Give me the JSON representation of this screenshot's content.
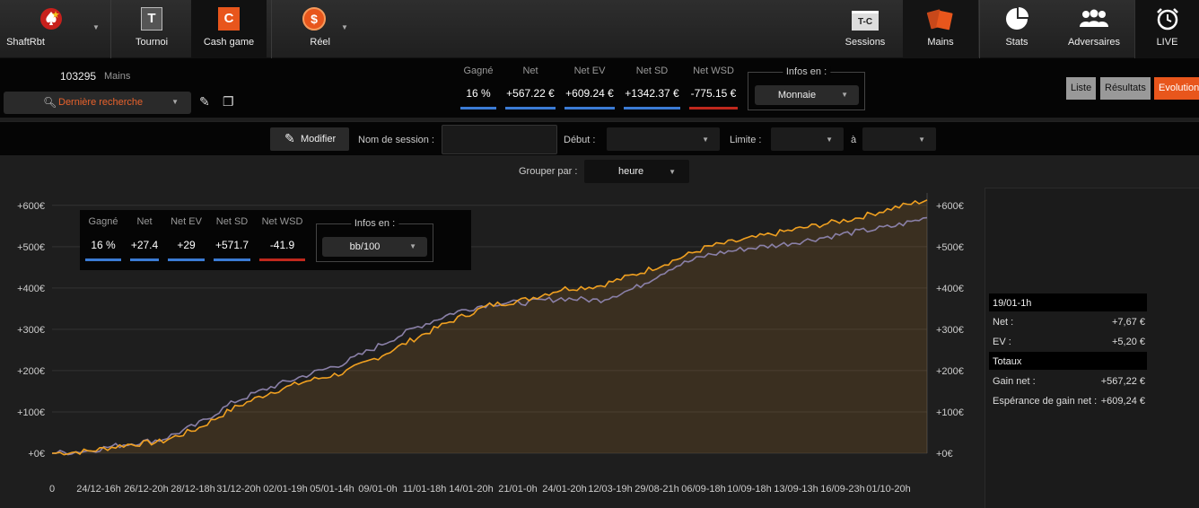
{
  "nav": {
    "left": [
      {
        "label": "ShaftRbt",
        "icon": "pokerstars-spade-icon"
      },
      {
        "label": "Tournoi",
        "icon": "tournament-t-icon"
      },
      {
        "label": "Cash game",
        "icon": "cash-game-c-icon"
      },
      {
        "label": "Réel",
        "icon": "dollar-coin-icon"
      }
    ],
    "right": [
      {
        "label": "Sessions",
        "icon": "tc-sessions-icon",
        "badge": "T-C"
      },
      {
        "label": "Mains",
        "icon": "cards-icon"
      },
      {
        "label": "Stats",
        "icon": "pie-chart-icon"
      },
      {
        "label": "Adversaires",
        "icon": "users-icon"
      },
      {
        "label": "LIVE",
        "icon": "alarm-clock-icon"
      }
    ]
  },
  "hands": {
    "count": "103295",
    "label": "Mains"
  },
  "search": {
    "label": "Dernière recherche"
  },
  "stats": [
    {
      "header": "Gagné",
      "value": "16 %",
      "color": "#3b7bd4"
    },
    {
      "header": "Net",
      "value": "+567.22 €",
      "color": "#3b7bd4"
    },
    {
      "header": "Net EV",
      "value": "+609.24 €",
      "color": "#3b7bd4"
    },
    {
      "header": "Net SD",
      "value": "+1342.37 €",
      "color": "#3b7bd4"
    },
    {
      "header": "Net WSD",
      "value": "-775.15 €",
      "color": "#c0281d"
    }
  ],
  "infos": {
    "title": "Infos en :",
    "value": "Monnaie"
  },
  "views": [
    "Liste",
    "Résultats",
    "Evolution"
  ],
  "filters": {
    "modify": "Modifier",
    "session_name": "Nom de session :",
    "start": "Début :",
    "limit": "Limite :",
    "to": "à"
  },
  "group": {
    "label": "Grouper par :",
    "value": "heure"
  },
  "inner_stats": [
    {
      "header": "Gagné",
      "value": "16 %",
      "color": "#3b7bd4"
    },
    {
      "header": "Net",
      "value": "+27.4",
      "color": "#3b7bd4"
    },
    {
      "header": "Net EV",
      "value": "+29",
      "color": "#3b7bd4"
    },
    {
      "header": "Net SD",
      "value": "+571.7",
      "color": "#3b7bd4"
    },
    {
      "header": "Net WSD",
      "value": "-41.9",
      "color": "#c0281d"
    }
  ],
  "inner_infos": {
    "title": "Infos en :",
    "value": "bb/100"
  },
  "side": {
    "period": "19/01-1h",
    "net_label": "Net :",
    "net": "+7,67 €",
    "ev_label": "EV :",
    "ev": "+5,20 €",
    "totals": "Totaux",
    "gain_label": "Gain net :",
    "gain": "+567,22 €",
    "esp_label": "Espérance de gain net :",
    "esp": "+609,24 €"
  },
  "chart_data": {
    "type": "line",
    "ylim": [
      0,
      630
    ],
    "yticks": [
      "+0€",
      "+100€",
      "+200€",
      "+300€",
      "+400€",
      "+500€",
      "+600€"
    ],
    "xticks": [
      "0",
      "24/12-16h",
      "26/12-20h",
      "28/12-18h",
      "31/12-20h",
      "02/01-19h",
      "05/01-14h",
      "09/01-0h",
      "11/01-18h",
      "14/01-20h",
      "21/01-0h",
      "24/01-20h",
      "12/03-19h",
      "29/08-21h",
      "06/09-18h",
      "10/09-18h",
      "13/09-13h",
      "16/09-23h",
      "01/10-20h"
    ],
    "series": [
      {
        "color": "#f0a020",
        "values": [
          0,
          5,
          20,
          28,
          60,
          110,
          148,
          175,
          195,
          235,
          280,
          322,
          358,
          372,
          398,
          405,
          433,
          465,
          500,
          517,
          535,
          552,
          568,
          592,
          613
        ]
      },
      {
        "color": "#8a80a8",
        "values": [
          0,
          6,
          22,
          33,
          70,
          125,
          160,
          190,
          218,
          262,
          305,
          340,
          362,
          365,
          375,
          370,
          400,
          450,
          480,
          495,
          505,
          520,
          535,
          548,
          570
        ]
      }
    ]
  },
  "colors": {
    "accent": "#e8561c",
    "orange_line": "#f0a020",
    "purple_line": "#8a80a8"
  }
}
